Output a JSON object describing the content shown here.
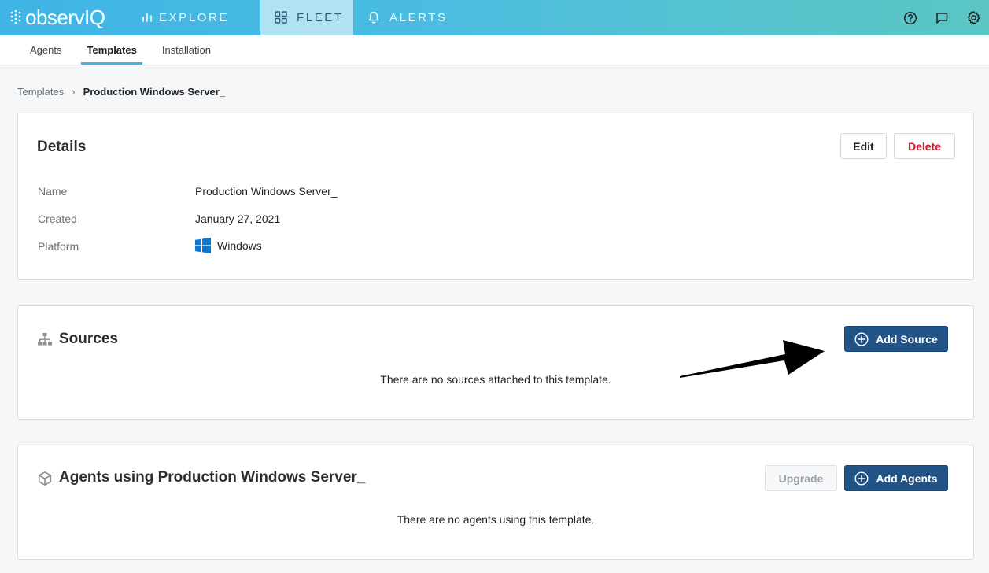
{
  "app": {
    "logo_text": "observIQ",
    "nav": [
      {
        "label": "EXPLORE",
        "icon": "bar-chart-icon",
        "active": false
      },
      {
        "label": "FLEET",
        "icon": "grid-icon",
        "active": true
      },
      {
        "label": "ALERTS",
        "icon": "bell-icon",
        "active": false
      }
    ],
    "top_icons": [
      "help-icon",
      "chat-icon",
      "settings-icon"
    ]
  },
  "subnav": {
    "tabs": [
      {
        "label": "Agents",
        "active": false
      },
      {
        "label": "Templates",
        "active": true
      },
      {
        "label": "Installation",
        "active": false
      }
    ]
  },
  "breadcrumb": {
    "parent": "Templates",
    "separator": "›",
    "current": "Production Windows Server_"
  },
  "details": {
    "title": "Details",
    "edit_label": "Edit",
    "delete_label": "Delete",
    "fields": {
      "name_label": "Name",
      "name_value": "Production Windows Server_",
      "created_label": "Created",
      "created_value": "January 27, 2021",
      "platform_label": "Platform",
      "platform_value": "Windows"
    }
  },
  "sources": {
    "title": "Sources",
    "add_label": "Add Source",
    "empty_text": "There are no sources attached to this template."
  },
  "agents": {
    "title": "Agents using Production Windows Server_",
    "upgrade_label": "Upgrade",
    "add_label": "Add Agents",
    "empty_text": "There are no agents using this template."
  },
  "colors": {
    "primary": "#215387",
    "danger": "#d11a2a",
    "accent": "#3fb4e5",
    "windows": "#0a78d4"
  }
}
